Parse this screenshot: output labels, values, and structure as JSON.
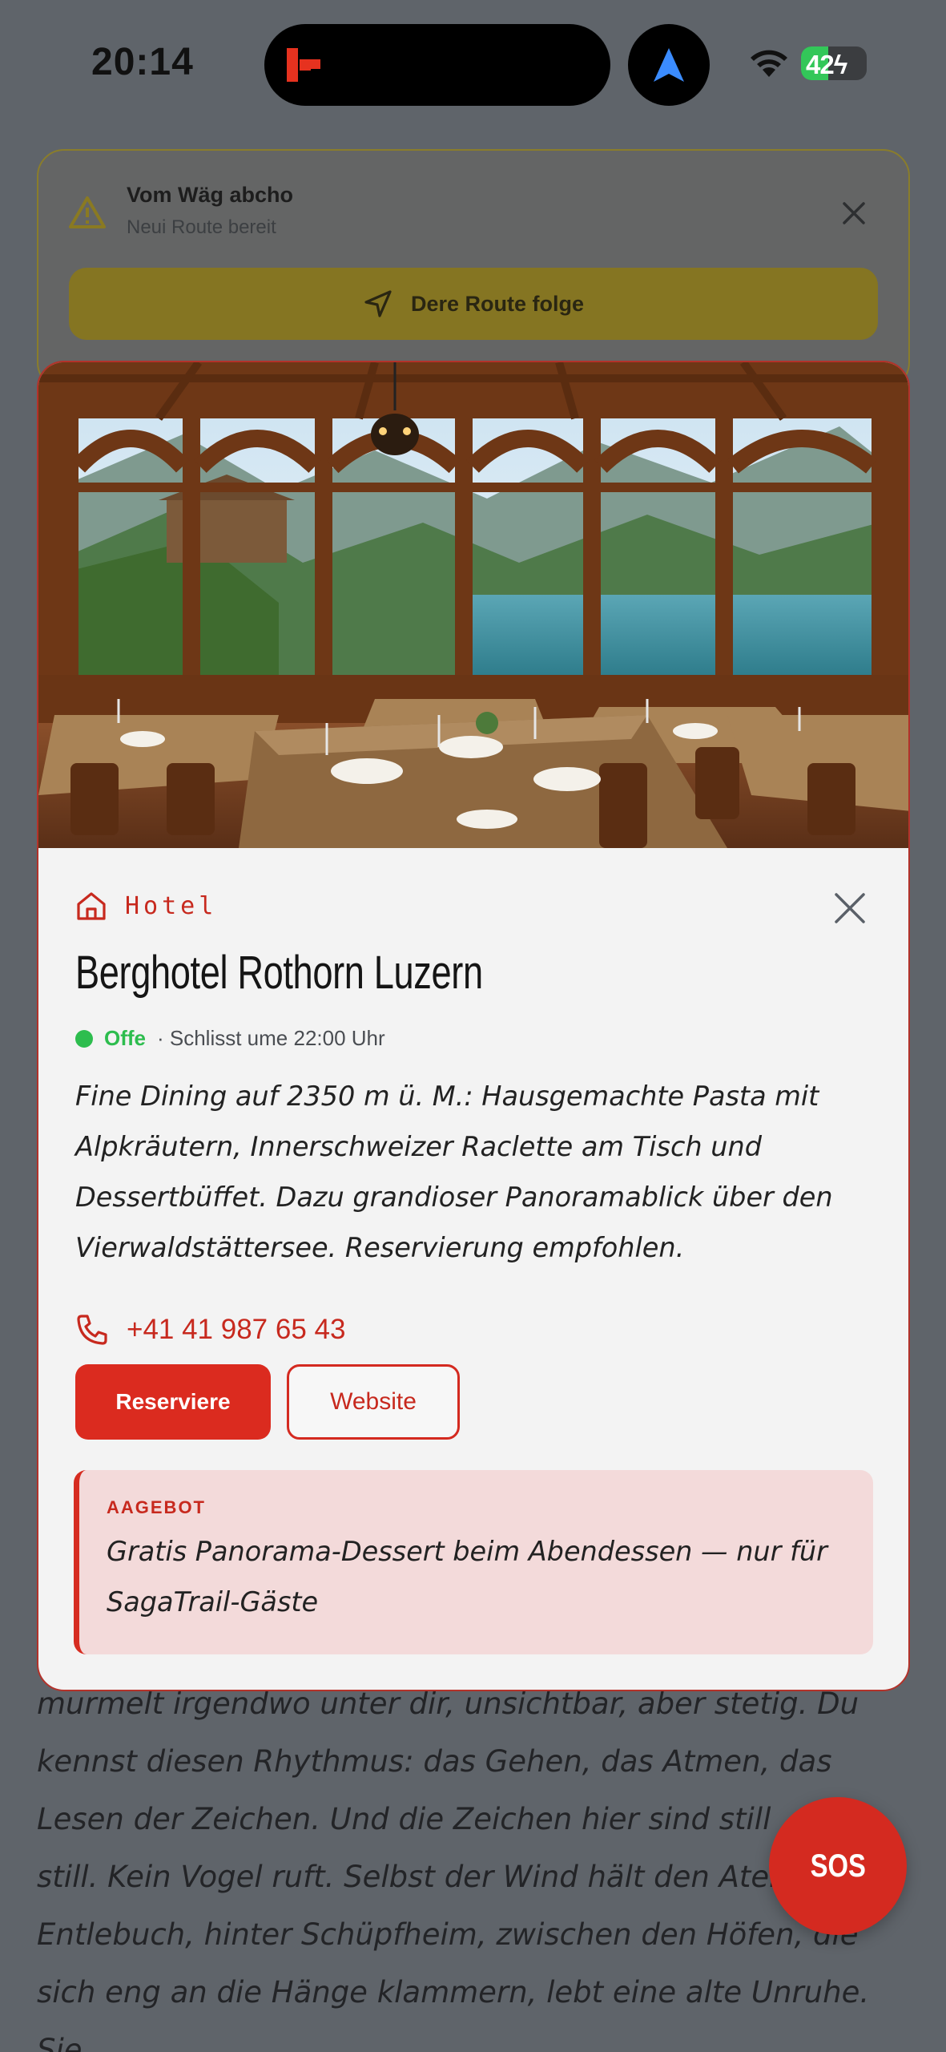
{
  "status_bar": {
    "time": "20:14",
    "battery_level": "42",
    "battery_fraction": 0.42,
    "island_logo_icon": "app-logo-icon",
    "nav_icon": "navigation-arrow-icon",
    "wifi_icon": "wifi-icon"
  },
  "reroute": {
    "title": "Vom Wäg abcho",
    "subtitle": "Neui Route bereit",
    "follow_label": "Dere Route folge",
    "icons": [
      "warning-icon",
      "close-icon",
      "navigation-icon"
    ]
  },
  "place": {
    "category": "Hotel",
    "name": "Berghotel Rothorn Luzern",
    "status_open": "Offe",
    "status_hours": "· Schlisst ume 22:00 Uhr",
    "description": "Fine Dining auf 2350 m ü. M.: Hausgemachte Pasta mit Alpkräutern, Innerschweizer Raclette am Tisch und Dessertbüffet. Dazu grandioser Panoramablick über den Vierwaldstättersee. Reservierung empfohlen.",
    "phone": "+41 41 987 65 43",
    "reserve_label": "Reserviere",
    "website_label": "Website",
    "offer_label": "AAGEBOT",
    "offer_text": "Gratis Panorama-Dessert beim Abendessen — nur für SagaTrail-Gäste",
    "icons": [
      "hotel-icon",
      "close-icon",
      "phone-icon"
    ]
  },
  "story": {
    "line1": "murmelt irgendwo unter dir, unsichtbar, aber stetig. Du",
    "line2": "kennst diesen Rhythmus: das Gehen, das Atmen, das",
    "line3": "Lesen der Zeichen. Und die Zeichen hier sind still",
    "line4": "still. Kein Vogel ruft. Selbst der Wind hält den Atem",
    "line5": "Entlebuch, hinter Schüpfheim, zwischen den Höfen, die",
    "line6": "sich eng an die Hänge klammern, lebt eine alte Unruhe. Sie"
  },
  "sos": {
    "label": "SOS"
  },
  "colors": {
    "accent_red": "#d42a20",
    "open_green": "#2dbd4e",
    "reroute_yellow": "#857522",
    "scrim": "#5f646a"
  }
}
